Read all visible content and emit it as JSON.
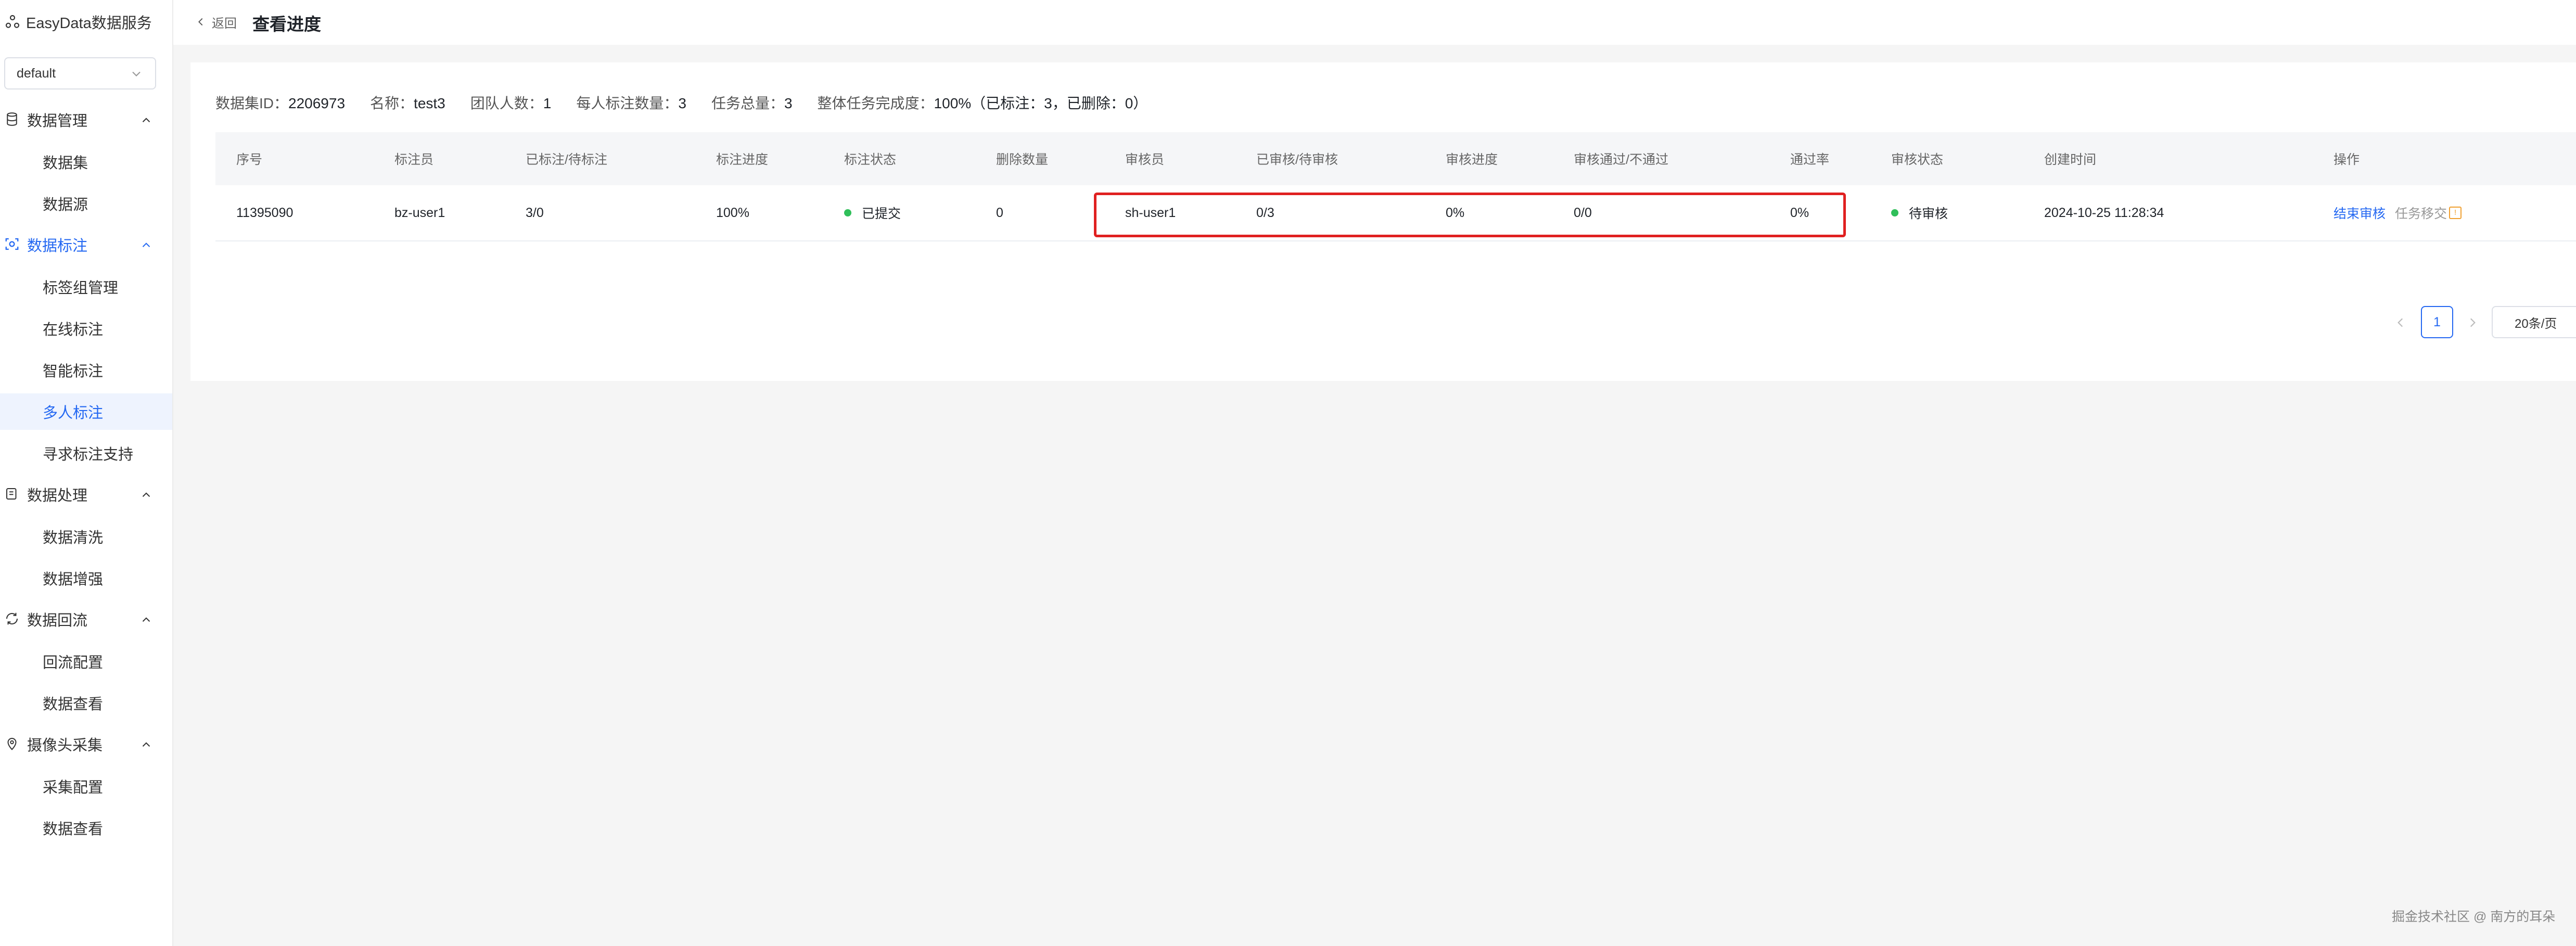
{
  "brand": {
    "title": "EasyData数据服务"
  },
  "workspace": {
    "selected": "default"
  },
  "sidebar": {
    "groups": [
      {
        "label": "数据管理",
        "icon": "database-icon",
        "items": [
          {
            "label": "数据集"
          },
          {
            "label": "数据源"
          }
        ]
      },
      {
        "label": "数据标注",
        "icon": "scan-icon",
        "items": [
          {
            "label": "标签组管理"
          },
          {
            "label": "在线标注"
          },
          {
            "label": "智能标注"
          },
          {
            "label": "多人标注"
          },
          {
            "label": "寻求标注支持"
          }
        ]
      },
      {
        "label": "数据处理",
        "icon": "process-icon",
        "items": [
          {
            "label": "数据清洗"
          },
          {
            "label": "数据增强"
          }
        ]
      },
      {
        "label": "数据回流",
        "icon": "refresh-icon",
        "items": [
          {
            "label": "回流配置"
          },
          {
            "label": "数据查看"
          }
        ]
      },
      {
        "label": "摄像头采集",
        "icon": "location-icon",
        "items": [
          {
            "label": "采集配置"
          },
          {
            "label": "数据查看"
          }
        ]
      }
    ],
    "active_item": "多人标注"
  },
  "header": {
    "back_label": "返回",
    "title": "查看进度"
  },
  "info": {
    "dataset_id_label": "数据集ID：",
    "dataset_id": "2206973",
    "name_label": "名称：",
    "name": "test3",
    "team_label": "团队人数：",
    "team": "1",
    "per_person_label": "每人标注数量：",
    "per_person": "3",
    "total_label": "任务总量：",
    "total": "3",
    "completion_label": "整体任务完成度：",
    "completion": "100%（已标注：3，已删除：0）"
  },
  "table": {
    "headers": [
      "序号",
      "标注员",
      "已标注/待标注",
      "标注进度",
      "标注状态",
      "删除数量",
      "审核员",
      "已审核/待审核",
      "审核进度",
      "审核通过/不通过",
      "通过率",
      "审核状态",
      "创建时间",
      "操作"
    ],
    "rows": [
      {
        "id": "11395090",
        "annotator": "bz-user1",
        "annotated": "3/0",
        "progress": "100%",
        "status": "已提交",
        "deleted": "0",
        "reviewer": "sh-user1",
        "reviewed": "0/3",
        "review_progress": "0%",
        "pass_fail": "0/0",
        "pass_rate": "0%",
        "review_status": "待审核",
        "created": "2024-10-25 11:28:34",
        "action_primary": "结束审核",
        "action_secondary": "任务移交"
      }
    ]
  },
  "status_colors": {
    "submitted": "#30bf5a",
    "pending": "#30bf5a",
    "highlight": "#e02020",
    "accent": "#2468f2"
  },
  "pagination": {
    "current": "1",
    "page_size": "20条/页"
  },
  "watermark": "掘金技术社区 @ 南方的耳朵"
}
